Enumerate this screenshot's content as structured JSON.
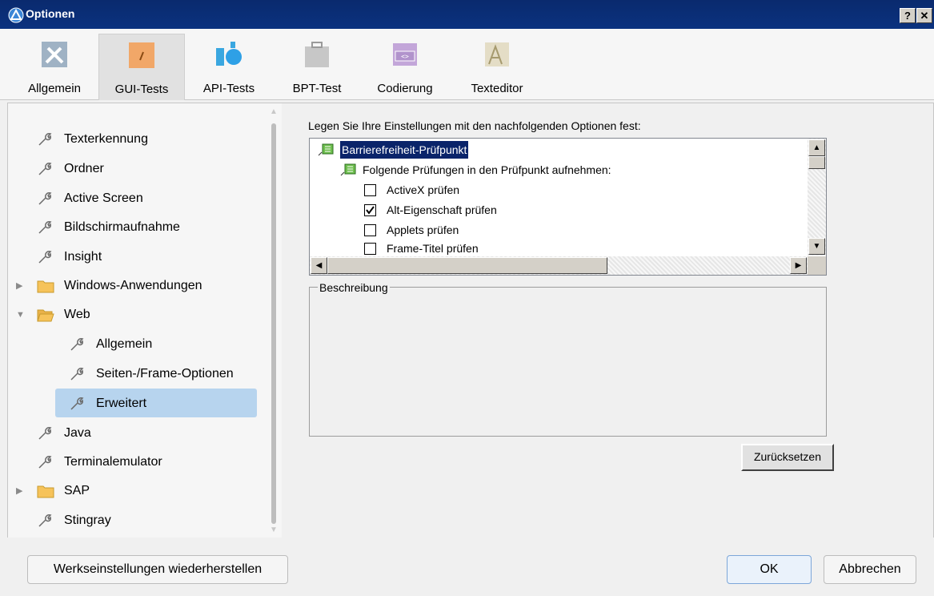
{
  "window": {
    "title": "Optionen",
    "help_btn": "?",
    "close_btn": "✕"
  },
  "tabs": [
    {
      "label": "Allgemein",
      "icon": "tools-icon"
    },
    {
      "label": "GUI-Tests",
      "icon": "gui-test-icon"
    },
    {
      "label": "API-Tests",
      "icon": "api-test-icon"
    },
    {
      "label": "BPT-Test",
      "icon": "briefcase-icon"
    },
    {
      "label": "Codierung",
      "icon": "code-icon"
    },
    {
      "label": "Texteditor",
      "icon": "text-editor-icon"
    }
  ],
  "active_tab": "GUI-Tests",
  "sidebar": {
    "items": [
      {
        "label": "Texterkennung",
        "type": "leaf"
      },
      {
        "label": "Ordner",
        "type": "leaf"
      },
      {
        "label": "Active Screen",
        "type": "leaf"
      },
      {
        "label": "Bildschirmaufnahme",
        "type": "leaf"
      },
      {
        "label": "Insight",
        "type": "leaf"
      },
      {
        "label": "Windows-Anwendungen",
        "type": "folder",
        "expanded": false
      },
      {
        "label": "Web",
        "type": "folder",
        "expanded": true
      },
      {
        "label": "Allgemein",
        "type": "leaf"
      },
      {
        "label": "Seiten-/Frame-Optionen",
        "type": "leaf"
      },
      {
        "label": "Erweitert",
        "type": "leaf",
        "selected": true
      },
      {
        "label": "Java",
        "type": "leaf"
      },
      {
        "label": "Terminalemulator",
        "type": "leaf"
      },
      {
        "label": "SAP",
        "type": "folder",
        "expanded": false
      },
      {
        "label": "Stingray",
        "type": "leaf"
      }
    ]
  },
  "main": {
    "prompt": "Legen Sie Ihre Einstellungen mit den nachfolgenden Optionen fest:",
    "list": {
      "root": "Barrierefreiheit-Prüfpunkt",
      "group": "Folgende Prüfungen in den Prüfpunkt aufnehmen:",
      "options": [
        {
          "label": "ActiveX prüfen",
          "checked": false
        },
        {
          "label": "Alt-Eigenschaft prüfen",
          "checked": true
        },
        {
          "label": "Applets prüfen",
          "checked": false
        },
        {
          "label": "Frame-Titel prüfen",
          "checked": false
        }
      ]
    },
    "description_label": "Beschreibung",
    "reset_button": "Zurücksetzen"
  },
  "footer": {
    "restore_defaults": "Werkseinstellungen wiederherstellen",
    "ok": "OK",
    "cancel": "Abbrechen"
  },
  "colors": {
    "titlebar": "#0b327f",
    "selection": "#b7d4ee",
    "list_selection": "#0a246a"
  }
}
